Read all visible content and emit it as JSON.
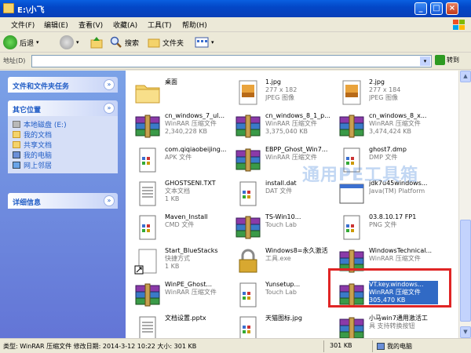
{
  "window": {
    "title": "E:\\小飞",
    "controls": [
      "_",
      "□",
      "×"
    ]
  },
  "menu": [
    "文件(F)",
    "编辑(E)",
    "查看(V)",
    "收藏(A)",
    "工具(T)",
    "帮助(H)"
  ],
  "toolbar": {
    "back": "后退",
    "search": "搜索",
    "folders": "文件夹"
  },
  "address": {
    "label": "地址(D)",
    "value": "",
    "go": "转到"
  },
  "sidebar": {
    "tasks_title": "文件和文件夹任务",
    "other_title": "其它位置",
    "other_items": [
      {
        "label": "本地磁盘 (E:)",
        "icon": "drive-icon"
      },
      {
        "label": "我的文档",
        "icon": "folder-icon"
      },
      {
        "label": "共享文档",
        "icon": "folder-icon"
      },
      {
        "label": "我的电脑",
        "icon": "computer-icon"
      },
      {
        "label": "网上邻居",
        "icon": "network-icon"
      }
    ],
    "details_title": "详细信息"
  },
  "files": [
    {
      "name": "桌面",
      "sub1": "",
      "sub2": "",
      "icon": "folder"
    },
    {
      "name": "1.jpg",
      "sub1": "277 x 182",
      "sub2": "JPEG 图像",
      "icon": "image"
    },
    {
      "name": "2.jpg",
      "sub1": "277 x 184",
      "sub2": "JPEG 图像",
      "icon": "image"
    },
    {
      "name": "cn_windows_7_ul...",
      "sub1": "WinRAR 压缩文件",
      "sub2": "2,340,228 KB",
      "icon": "rar"
    },
    {
      "name": "cn_windows_8_1_p...",
      "sub1": "WinRAR 压缩文件",
      "sub2": "3,375,040 KB",
      "icon": "rar"
    },
    {
      "name": "cn_windows_8_x...",
      "sub1": "WinRAR 压缩文件",
      "sub2": "3,474,424 KB",
      "icon": "rar"
    },
    {
      "name": "com.qiqiaobeijing...",
      "sub1": "APK 文件",
      "sub2": "",
      "icon": "doc"
    },
    {
      "name": "EBPP_Ghost_Win7...",
      "sub1": "WinRAR 压缩文件",
      "sub2": "",
      "icon": "rar"
    },
    {
      "name": "ghost7.dmp",
      "sub1": "DMP 文件",
      "sub2": "",
      "icon": "doc"
    },
    {
      "name": "GHOSTSENI.TXT",
      "sub1": "文本文档",
      "sub2": "1 KB",
      "icon": "txt"
    },
    {
      "name": "install.dat",
      "sub1": "DAT 文件",
      "sub2": "",
      "icon": "doc"
    },
    {
      "name": "jdk7u45windows...",
      "sub1": "Java(TM) Platform",
      "sub2": "",
      "icon": "app"
    },
    {
      "name": "Maven_Install",
      "sub1": "CMD 文件",
      "sub2": "",
      "icon": "doc"
    },
    {
      "name": "TS-Win10...",
      "sub1": "Touch Lab",
      "sub2": "",
      "icon": "rar"
    },
    {
      "name": "03.8.10.17 FP1",
      "sub1": "PNG 文件",
      "sub2": "",
      "icon": "doc"
    },
    {
      "name": "Start_BlueStacks",
      "sub1": "快捷方式",
      "sub2": "1 KB",
      "icon": "shortcut"
    },
    {
      "name": "Windows8=永久激活",
      "sub1": "工具.exe",
      "sub2": "",
      "icon": "lock"
    },
    {
      "name": "WindowsTechnical...",
      "sub1": "WinRAR 压缩文件",
      "sub2": "",
      "icon": "rar"
    },
    {
      "name": "WinPE_Ghost...",
      "sub1": "WinRAR 压缩文件",
      "sub2": "",
      "icon": "rar"
    },
    {
      "name": "Yunsetup...",
      "sub1": "Touch Lab",
      "sub2": "",
      "icon": "doc"
    },
    {
      "name": "VT.key.windows...",
      "sub1": "WinRAR 压缩文件",
      "sub2": "305,470 KB",
      "icon": "rar",
      "selected": true
    },
    {
      "name": "文档设置.pptx",
      "sub1": "",
      "sub2": "",
      "icon": "txt"
    },
    {
      "name": "天猫图标.jpg",
      "sub1": "",
      "sub2": "",
      "icon": "doc"
    },
    {
      "name": "小马win7通用激活工",
      "sub1": "具 支持转换按钮",
      "sub2": "",
      "icon": "rar"
    }
  ],
  "watermark": "通用PE工具箱",
  "status": {
    "left": "类型: WinRAR 压缩文件 修改日期: 2014-3-12 10:22 大小: 301 KB",
    "size": "301 KB",
    "location": "我的电脑"
  },
  "colors": {
    "titlebar": "#0347c7",
    "sidebar": "#6375d6",
    "selection": "#316ac5",
    "highlight": "#e02525"
  }
}
